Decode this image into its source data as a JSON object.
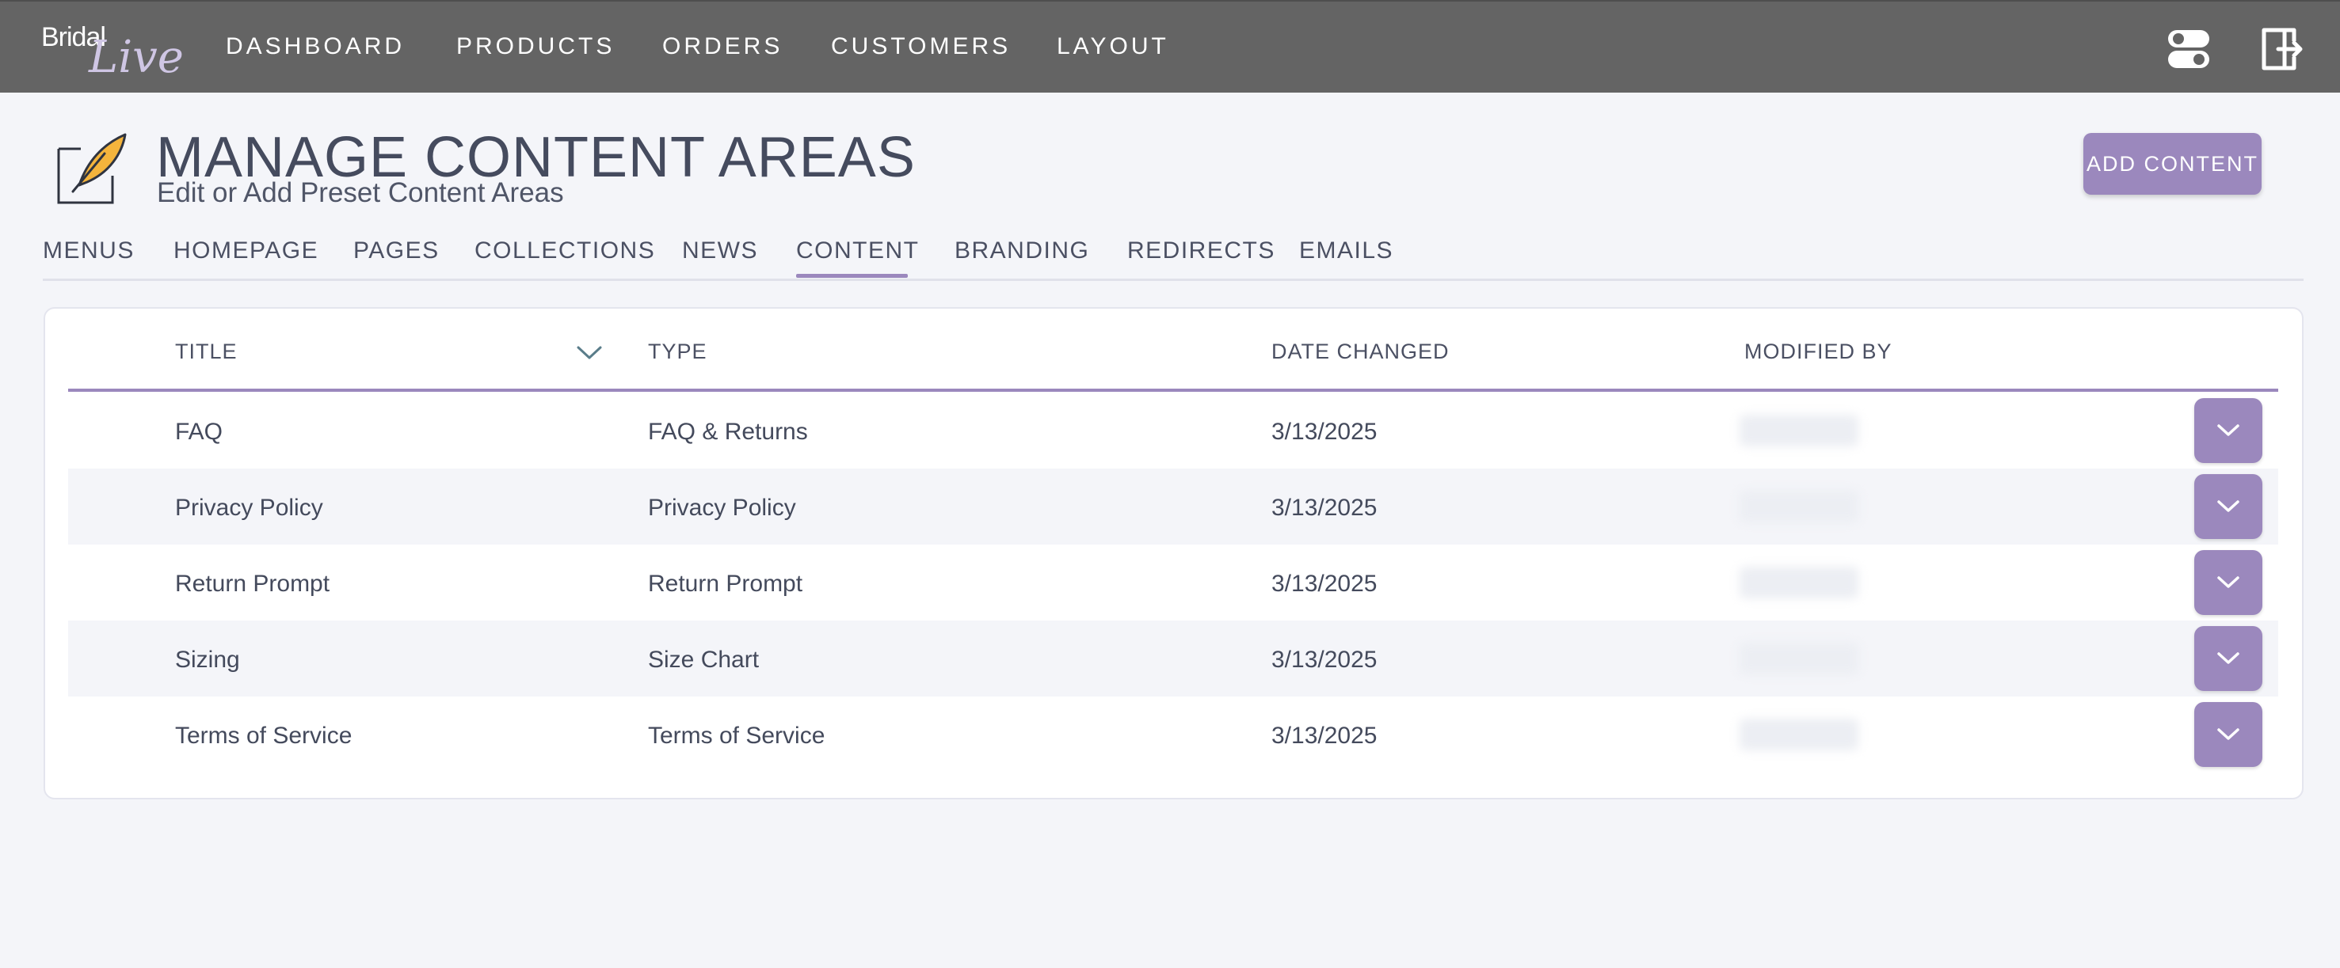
{
  "logo": {
    "line1": "Bridal",
    "line2": "Live"
  },
  "nav": {
    "items": [
      "DASHBOARD",
      "PRODUCTS",
      "ORDERS",
      "CUSTOMERS",
      "LAYOUT"
    ],
    "icons": [
      "toggle-settings-icon",
      "logout-icon"
    ]
  },
  "header": {
    "title": "MANAGE CONTENT AREAS",
    "subtitle": "Edit or Add Preset Content Areas",
    "icon": "edit-feather-icon",
    "add_button": "ADD CONTENT"
  },
  "tabs": {
    "items": [
      "MENUS",
      "HOMEPAGE",
      "PAGES",
      "COLLECTIONS",
      "NEWS",
      "CONTENT",
      "BRANDING",
      "REDIRECTS",
      "EMAILS"
    ],
    "active": "CONTENT"
  },
  "table": {
    "columns": [
      "TITLE",
      "TYPE",
      "DATE CHANGED",
      "MODIFIED BY"
    ],
    "sort_icon": "chevron-down-icon",
    "rows": [
      {
        "title": "FAQ",
        "type": "FAQ & Returns",
        "date": "3/13/2025"
      },
      {
        "title": "Privacy Policy",
        "type": "Privacy Policy",
        "date": "3/13/2025"
      },
      {
        "title": "Return Prompt",
        "type": "Return Prompt",
        "date": "3/13/2025"
      },
      {
        "title": "Sizing",
        "type": "Size Chart",
        "date": "3/13/2025"
      },
      {
        "title": "Terms of Service",
        "type": "Terms of Service",
        "date": "3/13/2025"
      }
    ]
  },
  "colors": {
    "accent": "#9b88bd",
    "topbar": "#646464",
    "background": "#f4f5f9",
    "text": "#444a5c"
  }
}
